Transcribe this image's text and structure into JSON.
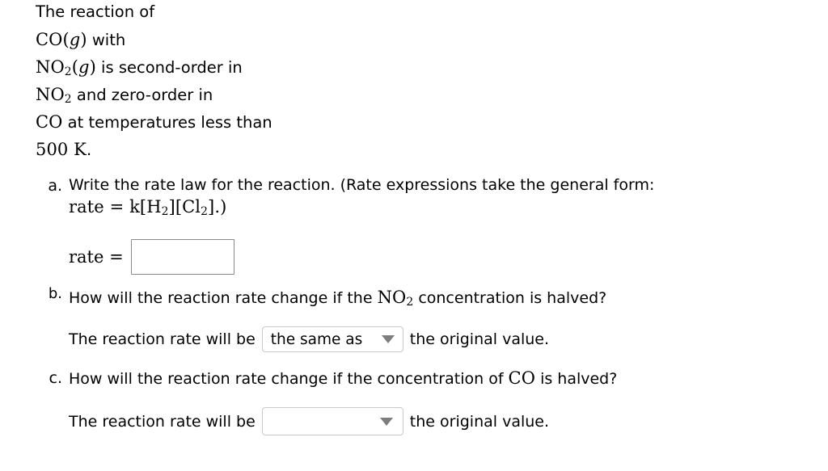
{
  "problem": {
    "intro_lines": [
      {
        "segments": [
          {
            "text": "The reaction of",
            "style": "sans"
          }
        ]
      },
      {
        "segments": [
          {
            "text": "CO",
            "style": "math"
          },
          {
            "text": "(",
            "style": "math"
          },
          {
            "text": "g",
            "style": "math-italic"
          },
          {
            "text": ")",
            "style": "math"
          },
          {
            "text": " with",
            "style": "sans"
          }
        ]
      },
      {
        "segments": [
          {
            "text": "NO",
            "style": "math"
          },
          {
            "text": "2",
            "style": "math-sub"
          },
          {
            "text": "(",
            "style": "math"
          },
          {
            "text": "g",
            "style": "math-italic"
          },
          {
            "text": ")",
            "style": "math"
          },
          {
            "text": " is second-order in",
            "style": "sans"
          }
        ]
      },
      {
        "segments": [
          {
            "text": "NO",
            "style": "math"
          },
          {
            "text": "2",
            "style": "math-sub"
          },
          {
            "text": " and zero-order in",
            "style": "sans"
          }
        ]
      },
      {
        "segments": [
          {
            "text": "CO",
            "style": "math"
          },
          {
            "text": " at temperatures less than",
            "style": "sans"
          }
        ]
      },
      {
        "segments": [
          {
            "text": "500 K",
            "style": "math"
          },
          {
            "text": ".",
            "style": "sans"
          }
        ]
      }
    ]
  },
  "parts": {
    "a": {
      "marker": "a.",
      "prompt": "Write the rate law for the reaction. (Rate expressions take the general form:",
      "formula": "rate = k[H2][Cl2].)",
      "rate_label": "rate =",
      "input_value": "",
      "input_placeholder": ""
    },
    "b": {
      "marker": "b.",
      "prompt_pre": "How will the reaction rate change if the ",
      "prompt_chem": "NO2",
      "prompt_post": " concentration is halved?",
      "answer_pre": "The reaction rate will be",
      "answer_post": "the original value.",
      "selected": "the same as"
    },
    "c": {
      "marker": "c.",
      "prompt_pre": "How will the reaction rate change if the concentration of ",
      "prompt_chem": "CO",
      "prompt_post": " is halved?",
      "answer_pre": "The reaction rate will be",
      "answer_post": "the original value.",
      "selected": ""
    }
  },
  "icons": {
    "caret": "chevron-down-icon"
  },
  "colors": {
    "text": "#000000",
    "background": "#ffffff",
    "input_border": "#8a8a8a",
    "dropdown_border": "#c9c9c9",
    "caret": "#7d7d7d"
  }
}
